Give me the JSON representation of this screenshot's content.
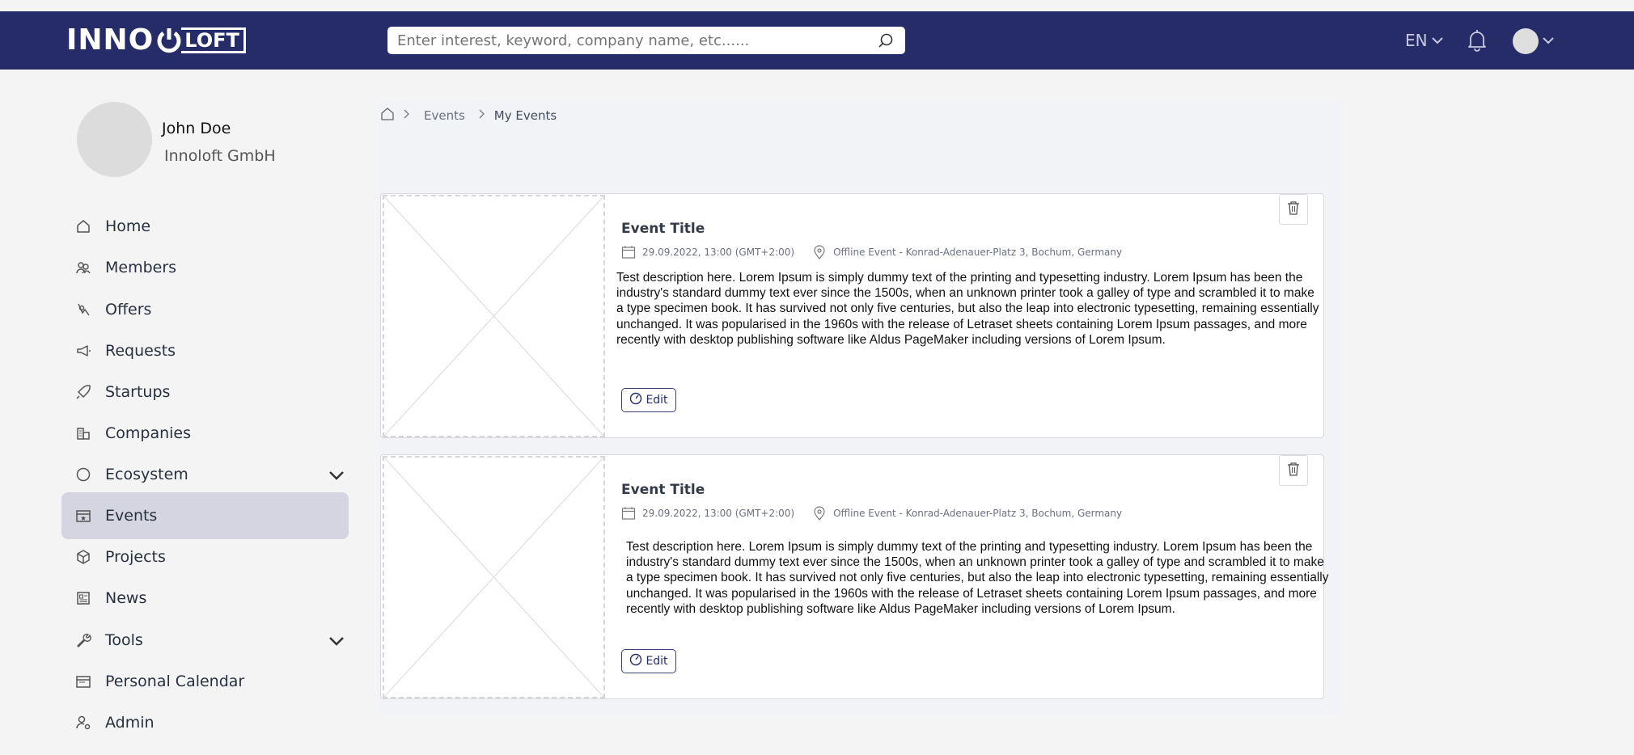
{
  "header": {
    "logo_text": "INNO",
    "logo_suffix": "LOFT",
    "search_placeholder": "Enter interest, keyword, company name, etc......",
    "language": "EN"
  },
  "profile": {
    "name": "John Doe",
    "company": "Innoloft GmbH"
  },
  "sidebar": {
    "items": [
      {
        "label": "Home",
        "icon": "home-icon"
      },
      {
        "label": "Members",
        "icon": "members-icon"
      },
      {
        "label": "Offers",
        "icon": "offers-icon"
      },
      {
        "label": "Requests",
        "icon": "megaphone-icon"
      },
      {
        "label": "Startups",
        "icon": "rocket-icon"
      },
      {
        "label": "Companies",
        "icon": "building-icon"
      },
      {
        "label": "Ecosystem",
        "icon": "circle-icon"
      },
      {
        "label": "Events",
        "icon": "calendar-star-icon",
        "active": true
      },
      {
        "label": "Projects",
        "icon": "cube-icon"
      },
      {
        "label": "News",
        "icon": "newspaper-icon"
      },
      {
        "label": "Tools",
        "icon": "wrench-icon"
      },
      {
        "label": "Personal Calendar",
        "icon": "calendar-icon"
      },
      {
        "label": "Admin",
        "icon": "admin-user-icon"
      }
    ]
  },
  "breadcrumb": {
    "items": [
      "Events",
      "My Events"
    ]
  },
  "events": [
    {
      "title": "Event Title",
      "datetime": "29.09.2022, 13:00 (GMT+2:00)",
      "location": "Offline Event - Konrad-Adenauer-Platz 3, Bochum, Germany",
      "description": "Test description here. Lorem Ipsum is simply dummy text of the printing and typesetting industry. Lorem Ipsum has been the industry's standard dummy text ever since the 1500s, when an unknown printer took a galley of type and scrambled it to make a type specimen book. It has survived not only five centuries, but also the leap into electronic typesetting, remaining essentially unchanged. It was popularised in the 1960s with the release of Letraset sheets containing Lorem Ipsum passages, and more recently with desktop publishing software like Aldus PageMaker including versions of Lorem Ipsum.",
      "edit_label": "Edit"
    },
    {
      "title": "Event Title",
      "datetime": "29.09.2022, 13:00 (GMT+2:00)",
      "location": "Offline Event - Konrad-Adenauer-Platz 3, Bochum, Germany",
      "description": "Test description here. Lorem Ipsum is simply dummy text of the printing and typesetting industry. Lorem Ipsum has been the industry's standard dummy text ever since the 1500s, when an unknown printer took a galley of type and scrambled it to make a type specimen book. It has survived not only five centuries, but also the leap into electronic typesetting, remaining essentially unchanged. It was popularised in the 1960s with the release of Letraset sheets containing Lorem Ipsum passages, and more recently with desktop publishing software like Aldus PageMaker including versions of Lorem Ipsum.",
      "edit_label": "Edit"
    }
  ],
  "colors": {
    "header_bg": "#262c68",
    "active_nav_bg": "#d5d5e1",
    "page_bg": "#f4f4f5"
  }
}
